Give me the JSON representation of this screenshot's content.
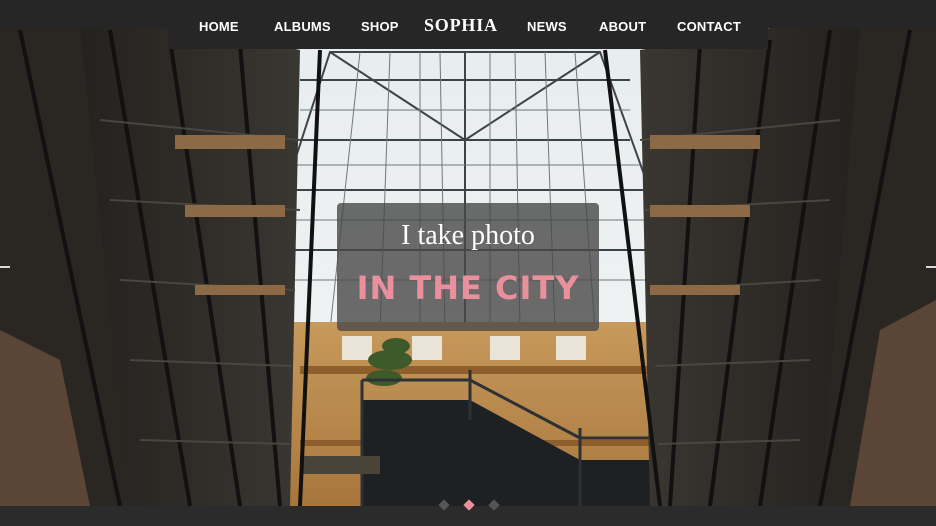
{
  "nav": {
    "items": [
      {
        "label": "HOME"
      },
      {
        "label": "ALBUMS"
      },
      {
        "label": "SHOP"
      },
      {
        "label": "NEWS"
      },
      {
        "label": "ABOUT"
      },
      {
        "label": "CONTACT"
      }
    ],
    "brand": "SOPHIA"
  },
  "hero": {
    "subtitle": "I take photo",
    "title": "IN THE CITY"
  },
  "slider": {
    "slide_count": 3,
    "active_index": 1,
    "prev_icon": "arrow-left-icon",
    "next_icon": "arrow-right-icon"
  },
  "colors": {
    "accent": "#e9909c",
    "nav_background": "#262626",
    "dot_inactive": "#555555"
  }
}
